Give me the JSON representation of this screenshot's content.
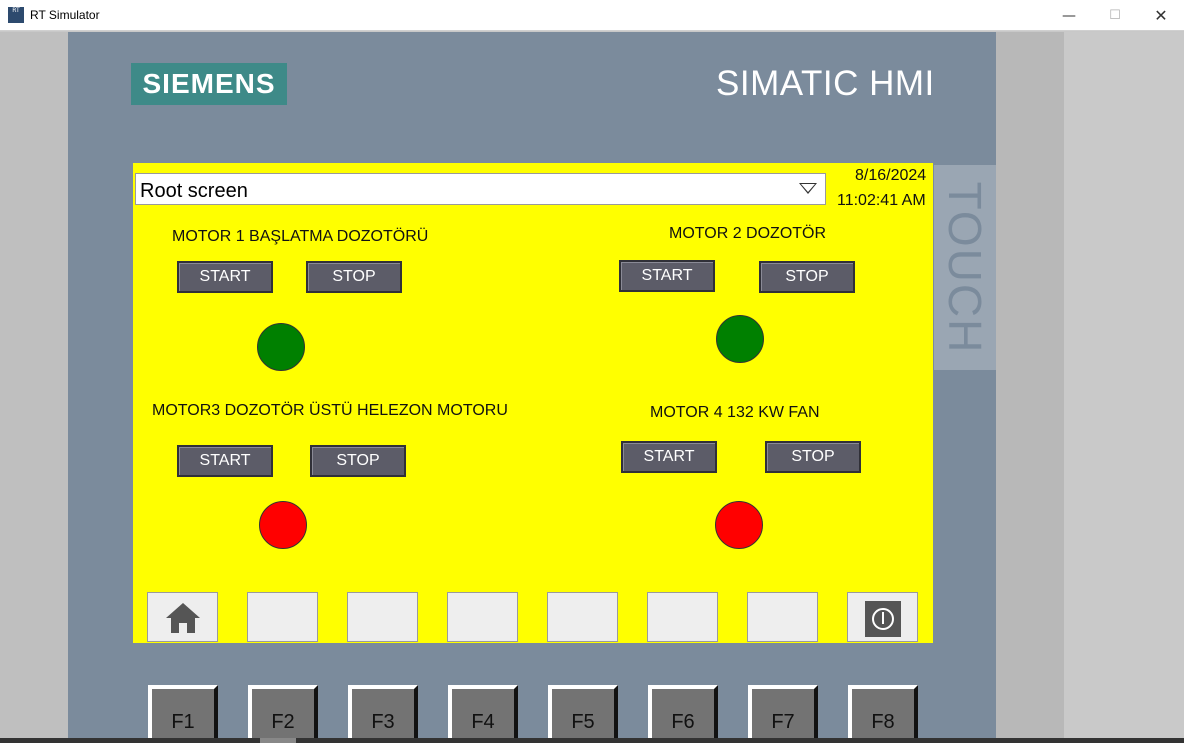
{
  "window": {
    "icon_text": "RT",
    "title": "RT Simulator",
    "minimize": "—",
    "maximize": "☐",
    "close": "✕"
  },
  "device": {
    "brand": "SIEMENS",
    "product": "SIMATIC HMI",
    "side_label": "TOUCH"
  },
  "screen": {
    "selector_value": "Root screen",
    "date": "8/16/2024",
    "time": "11:02:41 AM",
    "motors": [
      {
        "title": "MOTOR 1 BAŞLATMA DOZOTÖRÜ",
        "start": "START",
        "stop": "STOP",
        "status_color": "#008000",
        "status": "running"
      },
      {
        "title": "MOTOR 2 DOZOTÖR",
        "start": "START",
        "stop": "STOP",
        "status_color": "#008000",
        "status": "running"
      },
      {
        "title": "MOTOR3 DOZOTÖR ÜSTÜ HELEZON MOTORU",
        "start": "START",
        "stop": "STOP",
        "status_color": "#ff0000",
        "status": "stopped"
      },
      {
        "title": "MOTOR 4 132 KW FAN",
        "start": "START",
        "stop": "STOP",
        "status_color": "#ff0000",
        "status": "stopped"
      }
    ],
    "softkeys": [
      {
        "icon": "home-icon"
      },
      {
        "icon": ""
      },
      {
        "icon": ""
      },
      {
        "icon": ""
      },
      {
        "icon": ""
      },
      {
        "icon": ""
      },
      {
        "icon": ""
      },
      {
        "icon": "power-icon"
      }
    ]
  },
  "function_keys": [
    "F1",
    "F2",
    "F3",
    "F4",
    "F5",
    "F6",
    "F7",
    "F8"
  ],
  "colors": {
    "screen_background": "#ffff00",
    "device_body": "#7b8b9c",
    "brand_teal": "#3e8a88",
    "button_fill": "#5c5c68"
  }
}
